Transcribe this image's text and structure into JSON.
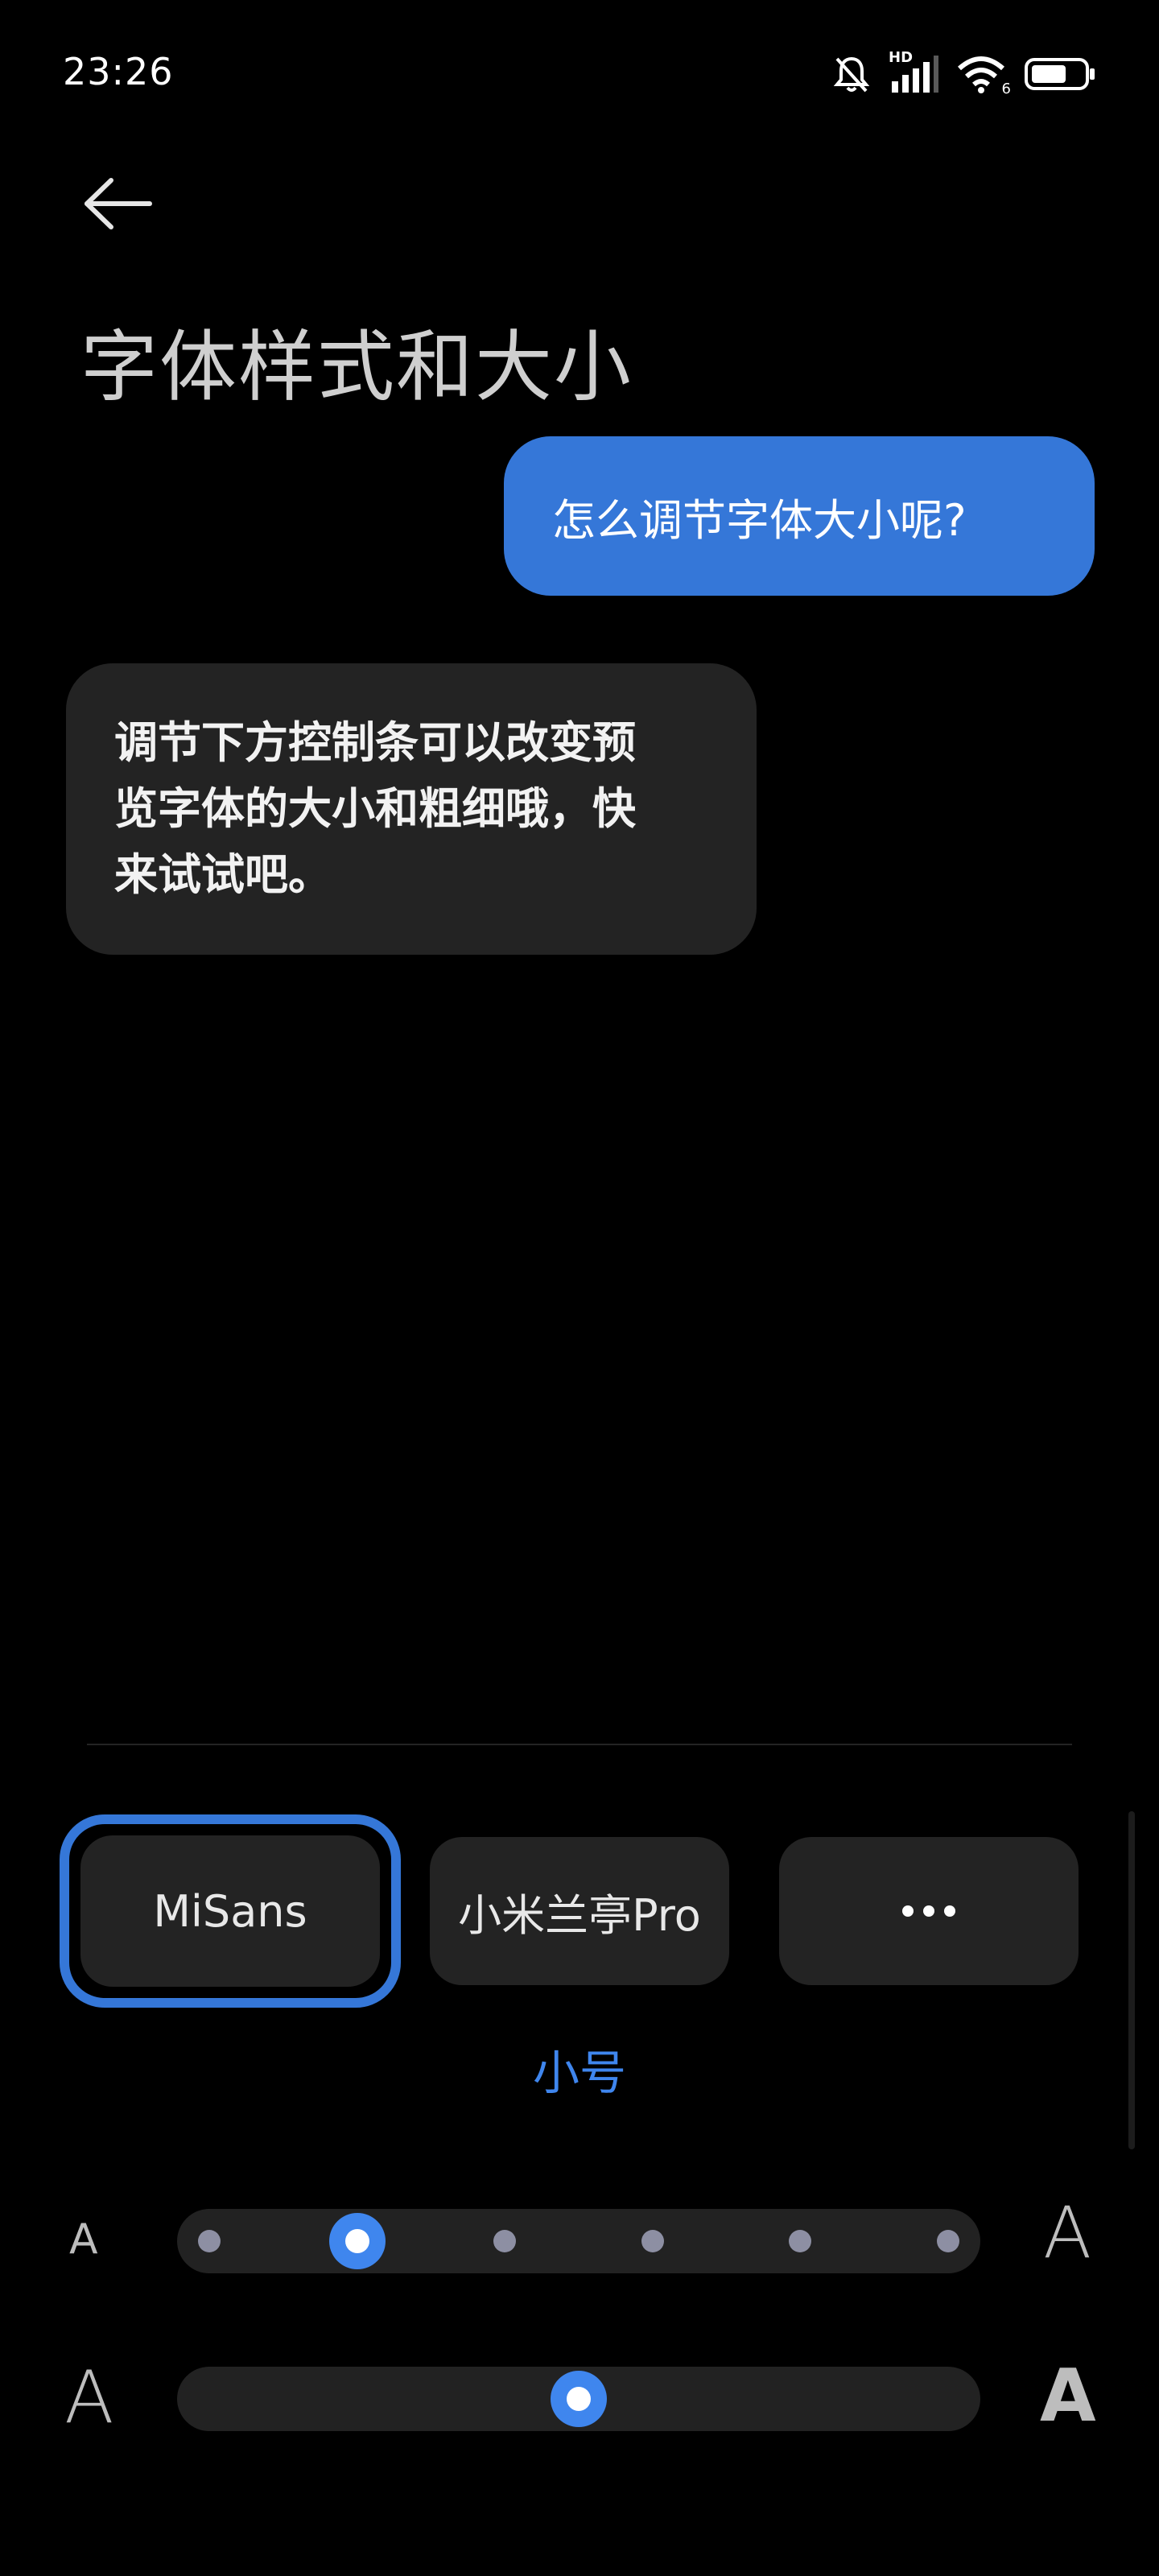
{
  "status_bar": {
    "time": "23:26",
    "network_label": "HD",
    "wifi_signal_label": "6",
    "icons": [
      "mute-bell-icon",
      "signal-icon",
      "wifi-icon",
      "battery-icon"
    ]
  },
  "header": {
    "title": "字体样式和大小",
    "back_icon": "back-arrow-icon"
  },
  "chat": {
    "user_message": "怎么调节字体大小呢?",
    "bot_message_lines": [
      "调节下方控制条可以改变预",
      "览字体的大小和粗细哦，快",
      "来试试吧。"
    ]
  },
  "font_options": [
    {
      "label": "MiSans",
      "selected": true
    },
    {
      "label": "小米兰亭Pro",
      "selected": false
    },
    {
      "label": "more",
      "icon": "more-dots-icon",
      "selected": false
    }
  ],
  "size": {
    "label": "小号",
    "min_label": "A",
    "max_label": "A",
    "steps": 6,
    "selected_index": 1
  },
  "weight": {
    "min_label": "A",
    "max_label": "A",
    "value": 0.5
  },
  "colors": {
    "accent": "#3577d8",
    "accent_text": "#3f86ee",
    "bubble_bot": "#232323",
    "background": "#000000"
  }
}
